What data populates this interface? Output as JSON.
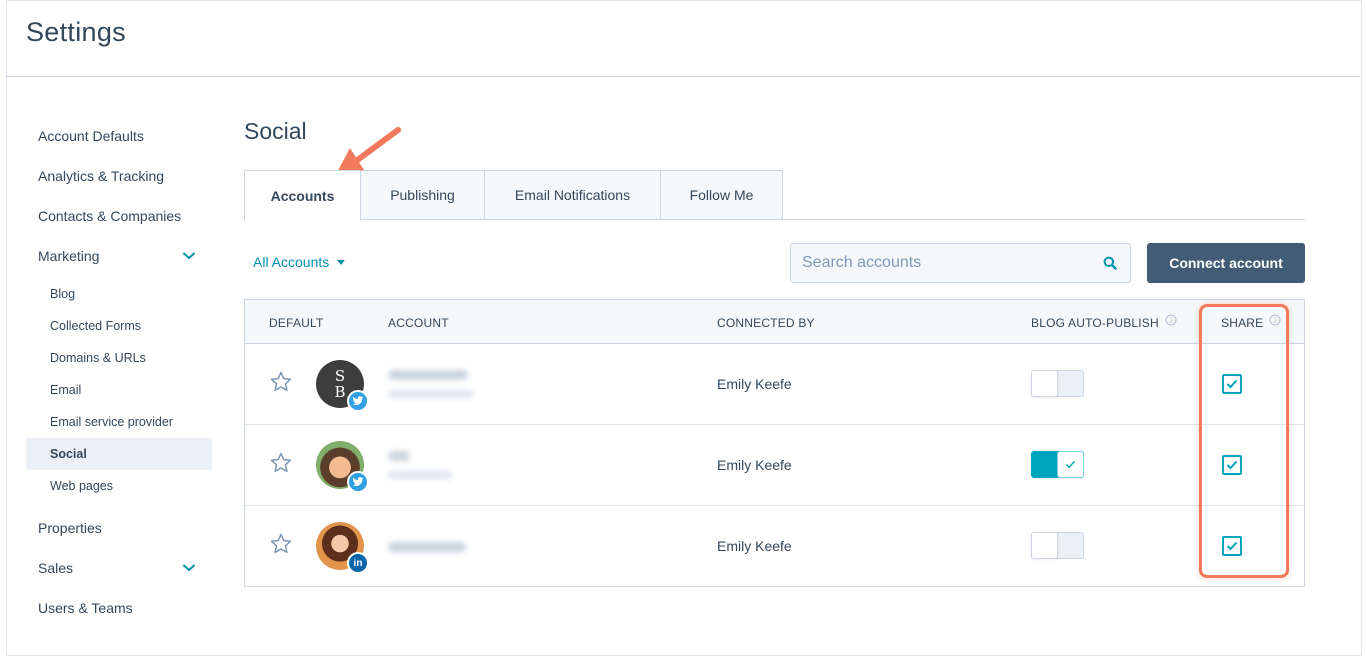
{
  "page": {
    "title": "Settings"
  },
  "colors": {
    "accent": "#0091ae",
    "primary_button": "#425b76",
    "toggle_on": "#00a4bd",
    "highlight": "#f2795b",
    "twitter": "#2fa0e6",
    "linkedin": "#0a66a8"
  },
  "sidebar": {
    "items": [
      {
        "label": "Account Defaults"
      },
      {
        "label": "Analytics & Tracking"
      },
      {
        "label": "Contacts & Companies"
      },
      {
        "label": "Marketing",
        "icon": "chevron-down-icon"
      },
      {
        "label": "Properties"
      },
      {
        "label": "Sales",
        "icon": "chevron-down-icon"
      },
      {
        "label": "Users & Teams"
      }
    ],
    "marketing_subitems": [
      {
        "label": "Blog"
      },
      {
        "label": "Collected Forms"
      },
      {
        "label": "Domains & URLs"
      },
      {
        "label": "Email"
      },
      {
        "label": "Email service provider"
      },
      {
        "label": "Social",
        "active": true
      },
      {
        "label": "Web pages"
      }
    ]
  },
  "main": {
    "section_title": "Social",
    "tabs": [
      {
        "label": "Accounts",
        "active": true
      },
      {
        "label": "Publishing"
      },
      {
        "label": "Email Notifications"
      },
      {
        "label": "Follow Me"
      }
    ],
    "filter": {
      "label": "All Accounts",
      "icon": "caret-down-icon"
    },
    "search": {
      "placeholder": "Search accounts",
      "value": "",
      "icon": "search-icon"
    },
    "connect_button": "Connect account"
  },
  "table": {
    "headers": {
      "default": "DEFAULT",
      "account": "ACCOUNT",
      "connected_by": "CONNECTED BY",
      "blog_auto_publish": "BLOG AUTO-PUBLISH",
      "share": "SHARE"
    },
    "rows": [
      {
        "avatar_initials": "S B",
        "network": "twitter",
        "connected_by": "Emily Keefe",
        "auto_publish": false,
        "share": true
      },
      {
        "network": "twitter",
        "connected_by": "Emily Keefe",
        "auto_publish": true,
        "share": true
      },
      {
        "network": "linkedin",
        "network_badge": "in",
        "connected_by": "Emily Keefe",
        "auto_publish": false,
        "share": true
      }
    ]
  }
}
